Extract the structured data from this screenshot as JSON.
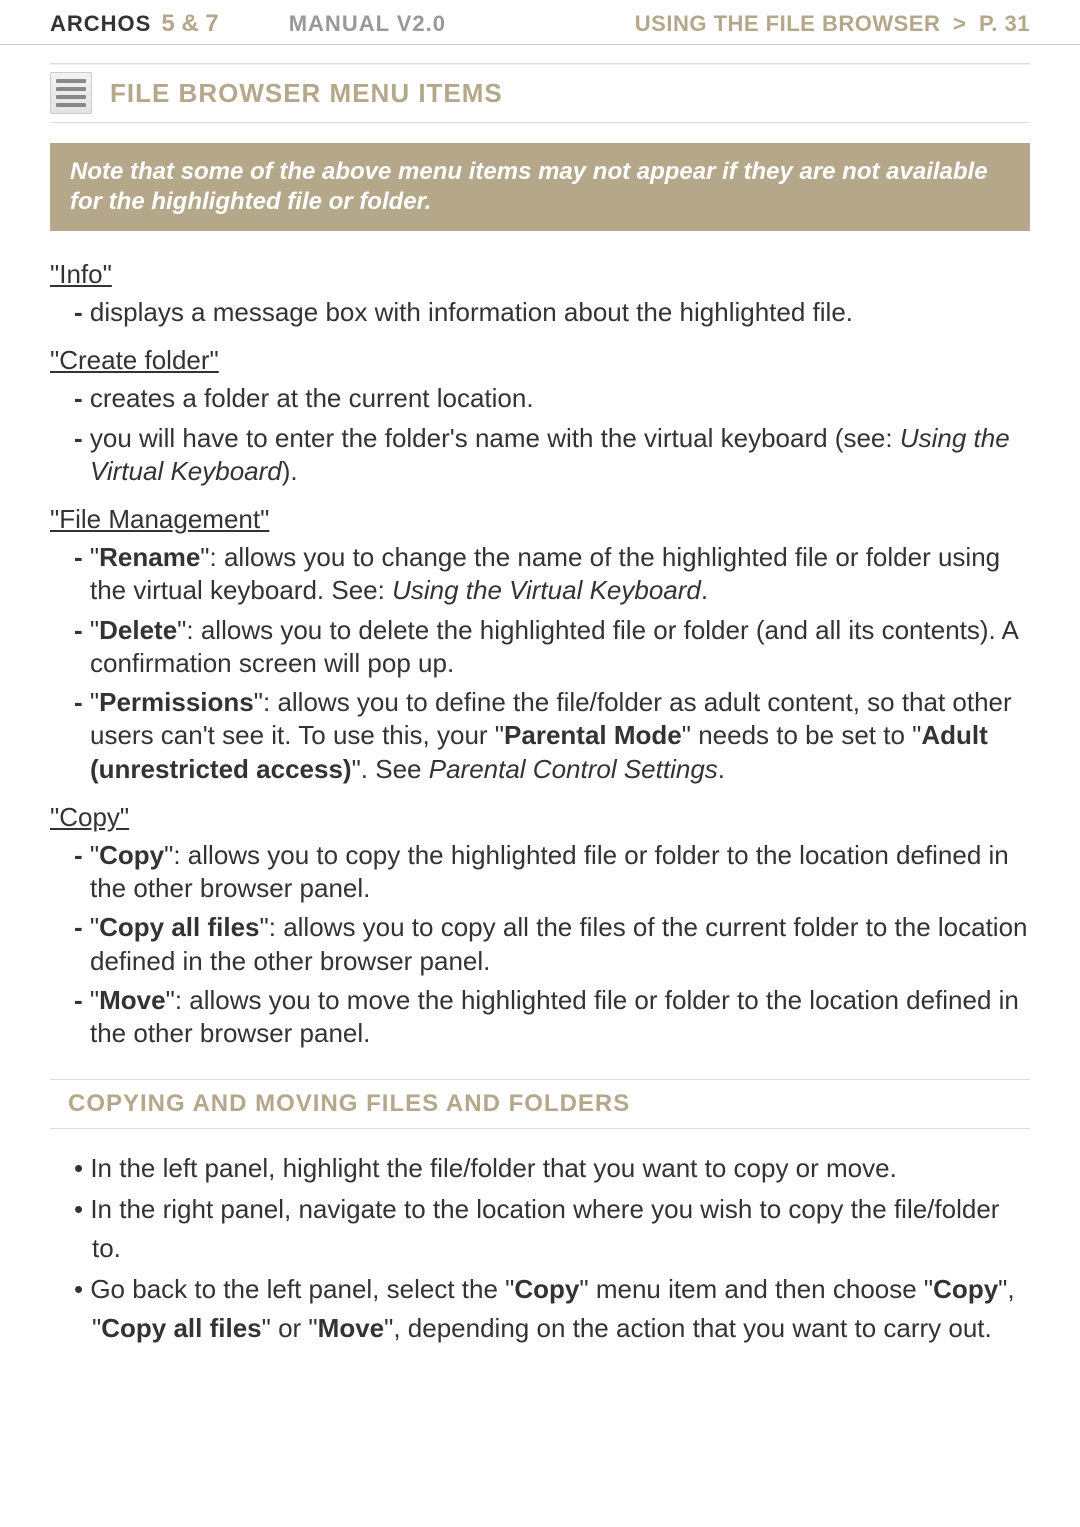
{
  "header": {
    "brand": "ARCHOS",
    "model": "5 & 7",
    "manual": "MANUAL V2.0",
    "location_prefix": "USING THE FILE BROWSER",
    "sep": ">",
    "page": "P. 31"
  },
  "section1": {
    "title": "FILE BROWSER MENU ITEMS"
  },
  "note": "Note that some of the above menu items may not appear if they are not available for the highlighted file or folder.",
  "info": {
    "heading": "\"Info\"",
    "items": [
      {
        "text": "displays a message box with information about the highlighted file."
      }
    ]
  },
  "create_folder": {
    "heading": "\"Create folder\"",
    "items": [
      {
        "text": "creates a folder at the current location."
      },
      {
        "prefix": "you will have to enter the folder's name with the virtual keyboard (see: ",
        "italic": "Using the Virtual Keyboard",
        "suffix": ")."
      }
    ]
  },
  "file_management": {
    "heading": "\"File Management\"",
    "items": [
      {
        "label": "Rename",
        "text1": "\": allows you to change the name of the highlighted file or folder using the virtual keyboard. See: ",
        "italic": "Using the Virtual Keyboard",
        "text2": "."
      },
      {
        "label": "Delete",
        "text1": "\": allows you to delete the highlighted file or folder (and all its contents). A confirmation screen will pop up."
      },
      {
        "label": "Permissions",
        "text1": "\": allows you to define the file/folder as adult content, so that other users can't see it. To use this, your \"",
        "bold1": "Parental Mode",
        "text2": "\" needs to be set to \"",
        "bold2": "Adult (unrestricted access)",
        "text3": "\". See ",
        "italic": "Parental Control Settings",
        "text4": "."
      }
    ]
  },
  "copy": {
    "heading": "\"Copy\"",
    "items": [
      {
        "label": "Copy",
        "text1": "\": allows you to copy the highlighted file or folder to the location defined in the other browser panel."
      },
      {
        "label": "Copy all files",
        "text1": "\": allows you to copy all the files of the current folder to the location defined in the other browser panel."
      },
      {
        "label": "Move",
        "text1": "\": allows you to move the highlighted file or folder to the location defined in the other browser panel."
      }
    ]
  },
  "section2": {
    "title": "COPYING AND MOVING FILES AND FOLDERS"
  },
  "steps": [
    {
      "text": "In the left panel, highlight the file/folder that you want to copy or move."
    },
    {
      "text": "In the right panel, navigate to the location where you wish to copy the file/folder to."
    },
    {
      "t1": "Go back to the left panel, select the \"",
      "b1": "Copy",
      "t2": "\" menu item and then choose \"",
      "b2": "Copy",
      "t3": "\", \"",
      "b3": "Copy all files",
      "t4": "\" or \"",
      "b4": "Move",
      "t5": "\", depending on the action that you want to carry out."
    }
  ]
}
